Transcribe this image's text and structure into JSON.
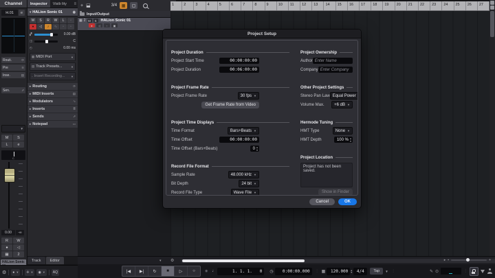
{
  "channel": {
    "header": "Channel",
    "name_abbrev": "H.01",
    "edit_label": "e",
    "quick_buttons": [
      {
        "label": "Routi.",
        "icon": "⟳",
        "gap": false
      },
      {
        "label": "Pre",
        "icon": "≋",
        "gap": false
      },
      {
        "label": "Inse.",
        "icon": "▤",
        "gap": false
      },
      {
        "label": "Sen.",
        "icon": "⇗",
        "gap": true
      }
    ],
    "mute": "M",
    "solo": "S",
    "listen": "L",
    "edit": "e",
    "pan_value": "C",
    "fader_value": "0.00",
    "peak_value": "-∞",
    "read": "R",
    "write": "W",
    "midi_channel": "2",
    "track_label": "HALion Sonic 01"
  },
  "inspector": {
    "tabs": {
      "inspector": "Inspector",
      "visibility": "Visib lity"
    },
    "track_title": "HALion Sonic 01",
    "buttons_row1": [
      "M",
      "S",
      "R",
      "W",
      "L"
    ],
    "volume_value": "0.00 dB",
    "pan_value": "C",
    "delay_value": "0.00 ms",
    "midi_port_row": "MIDI Port",
    "track_presets_row": "Track Presets...",
    "insert_recording_row": "Insert Recording...",
    "sections": [
      {
        "label": "Routing",
        "icon": "⟳"
      },
      {
        "label": "MIDI Inserts",
        "icon": "▤"
      },
      {
        "label": "Modulators",
        "icon": "∿"
      },
      {
        "label": "Inserts",
        "icon": "≣"
      },
      {
        "label": "Sends",
        "icon": "⇗"
      },
      {
        "label": "Notepad",
        "icon": "▭"
      }
    ],
    "bottom_tabs": {
      "track": "Track",
      "editor": "Editor"
    },
    "aq_label": "AQ"
  },
  "project": {
    "toolbar_counter": "3/4",
    "folder_track": "Input/Output",
    "track_number": "2",
    "track_name": "HALion Sonic 01",
    "track_mute": "M",
    "track_solo": "S",
    "ruler_bars": [
      1,
      2,
      3,
      4,
      5,
      6,
      7,
      8,
      9,
      10,
      11,
      12,
      13,
      14,
      15,
      16,
      17,
      18,
      19,
      20,
      21,
      22,
      23,
      24,
      25,
      26,
      27
    ]
  },
  "dialog": {
    "title": "Project Setup",
    "left_sections": [
      {
        "heading": "Project Duration",
        "rows": [
          {
            "label": "Project Start Time",
            "value": "00:00:00:00",
            "type": "time"
          },
          {
            "label": "Project Duration",
            "value": "00:06:00:00",
            "type": "time"
          }
        ]
      },
      {
        "heading": "Project Frame Rate",
        "rows": [
          {
            "label": "Project Frame Rate",
            "value": "30 fps",
            "type": "dropdown"
          },
          {
            "value": "Get Frame Rate from Video",
            "type": "button"
          }
        ]
      },
      {
        "heading": "Project Time Displays",
        "rows": [
          {
            "label": "Time Format",
            "value": "Bars+Beats",
            "type": "dropdown"
          },
          {
            "label": "Time Offset",
            "value": "00:00:00:00",
            "type": "time"
          },
          {
            "label": "Time Offset (Bars+Beats)",
            "value": "0",
            "type": "stepper"
          }
        ]
      },
      {
        "heading": "Record File Format",
        "rows": [
          {
            "label": "Sample Rate",
            "value": "48.000 kHz",
            "type": "dropdown"
          },
          {
            "label": "Bit Depth",
            "value": "24 bit",
            "type": "dropdown"
          },
          {
            "label": "Record File Type",
            "value": "Wave File",
            "type": "dropdown"
          }
        ]
      }
    ],
    "right_sections": [
      {
        "heading": "Project Ownership",
        "rows": [
          {
            "label": "Author",
            "value": "Enter Name",
            "type": "input"
          },
          {
            "label": "Company",
            "value": "Enter Company",
            "type": "input"
          }
        ]
      },
      {
        "heading": "Other Project Settings",
        "rows": [
          {
            "label": "Stereo Pan Law",
            "value": "Equal Power",
            "type": "dropdown"
          },
          {
            "label": "Volume Max.",
            "value": "+6 dB",
            "type": "dropdown"
          }
        ]
      },
      {
        "heading": "Hermode Tuning",
        "rows": [
          {
            "label": "HMT Type",
            "value": "None",
            "type": "dropdown"
          },
          {
            "label": "HMT Depth",
            "value": "100 %",
            "type": "stepper"
          }
        ]
      },
      {
        "heading": "Project Location",
        "message": "Project has not been saved.",
        "button": "Show in Finder"
      }
    ],
    "cancel_label": "Cancel",
    "ok_label": "OK"
  },
  "transport": {
    "position": "1. 1. 1.   0",
    "time": "0:00:00.000",
    "tempo": "120.000",
    "time_signature": "4/4",
    "tap_label": "Tap"
  },
  "colors": {
    "accent_blue": "#1877e8",
    "record_red": "#c33030",
    "snap_orange": "#cd862e",
    "slider_blue": "#2d8fd0"
  }
}
